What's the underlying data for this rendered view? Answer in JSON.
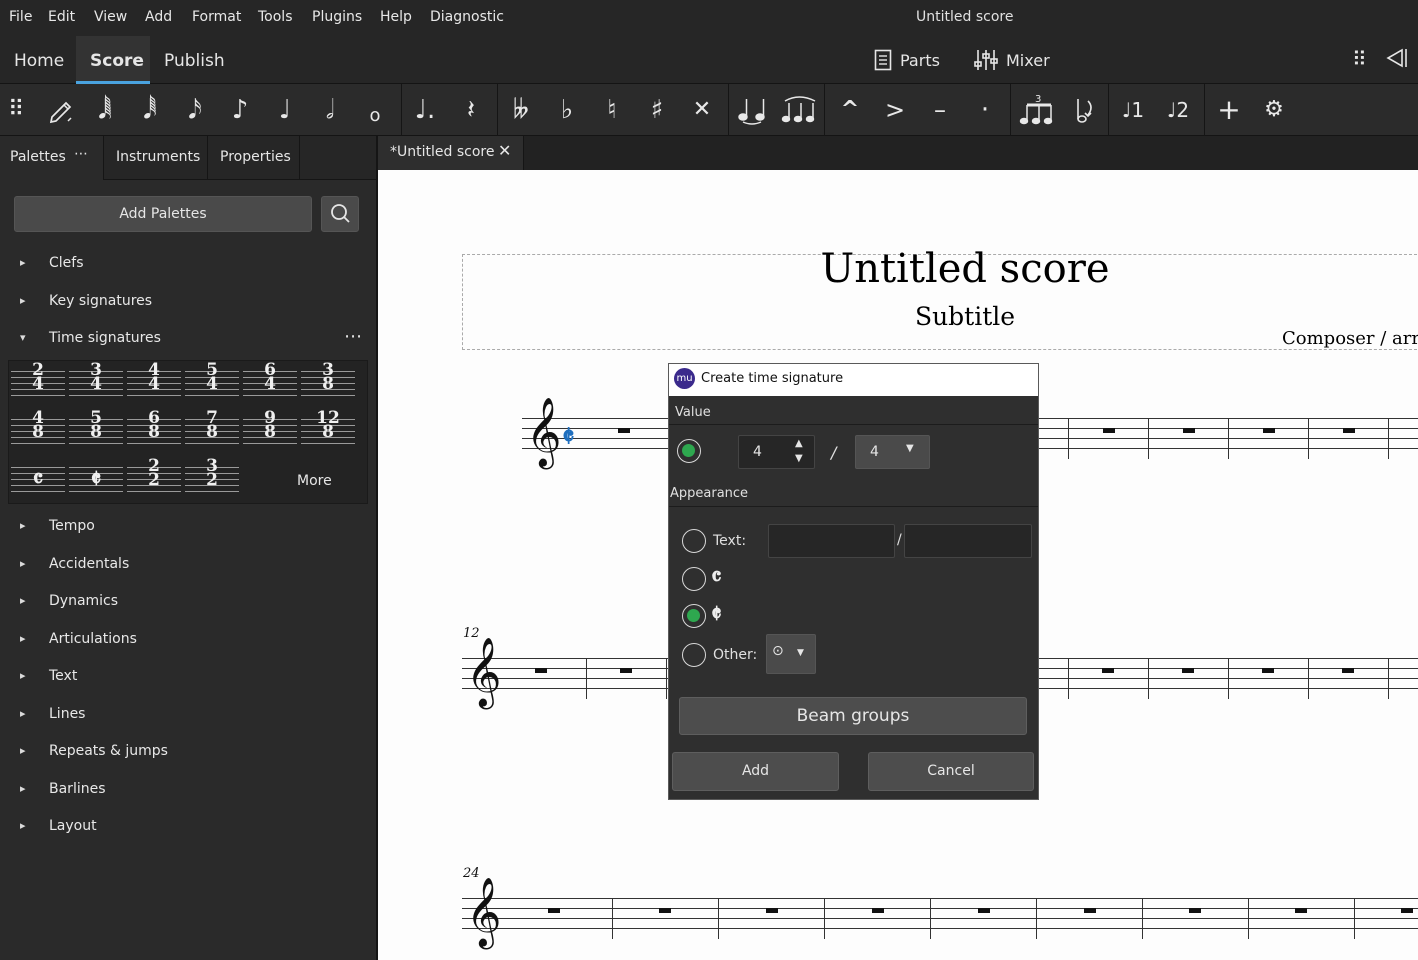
{
  "menu": [
    "File",
    "Edit",
    "View",
    "Add",
    "Format",
    "Tools",
    "Plugins",
    "Help",
    "Diagnostic"
  ],
  "app_title": "Untitled score",
  "workspace_tabs": [
    "Home",
    "Score",
    "Publish"
  ],
  "top_right": {
    "parts": "Parts",
    "mixer": "Mixer"
  },
  "toolbar_icons": [
    "drag-handle-icon",
    "note-input-pen-icon",
    "64th-note-icon",
    "32nd-note-icon",
    "16th-note-icon",
    "eighth-note-icon",
    "quarter-note-icon",
    "half-note-icon",
    "whole-note-icon",
    "augmentation-dot-icon",
    "rest-icon",
    "double-flat-icon",
    "flat-icon",
    "natural-icon",
    "sharp-icon",
    "double-sharp-icon",
    "tie-icon",
    "slur-icon",
    "marcato-icon",
    "accent-icon",
    "tenuto-icon",
    "staccato-icon",
    "tuplet-icon",
    "flip-direction-icon",
    "voice-1-icon",
    "voice-2-icon",
    "add-icon",
    "customize-toolbar-icon"
  ],
  "left_panel": {
    "tabs": [
      "Palettes",
      "Instruments",
      "Properties"
    ],
    "add_palettes": "Add Palettes",
    "palettes_before": [
      "Clefs",
      "Key signatures"
    ],
    "open_palette": "Time signatures",
    "time_signatures": [
      {
        "n": "2",
        "d": "4"
      },
      {
        "n": "3",
        "d": "4"
      },
      {
        "n": "4",
        "d": "4"
      },
      {
        "n": "5",
        "d": "4"
      },
      {
        "n": "6",
        "d": "4"
      },
      {
        "n": "3",
        "d": "8"
      },
      {
        "n": "4",
        "d": "8"
      },
      {
        "n": "5",
        "d": "8"
      },
      {
        "n": "6",
        "d": "8"
      },
      {
        "n": "7",
        "d": "8"
      },
      {
        "n": "9",
        "d": "8"
      },
      {
        "n": "12",
        "d": "8"
      }
    ],
    "time_signature_symbols": [
      "𝄴",
      "𝄵"
    ],
    "time_signature_extra": [
      {
        "n": "2",
        "d": "2"
      },
      {
        "n": "3",
        "d": "2"
      }
    ],
    "more": "More",
    "palettes_after": [
      "Tempo",
      "Accidentals",
      "Dynamics",
      "Articulations",
      "Text",
      "Lines",
      "Repeats & jumps",
      "Barlines",
      "Layout"
    ]
  },
  "document_tab": "*Untitled score",
  "score": {
    "title": "Untitled score",
    "subtitle": "Subtitle",
    "composer": "Composer / arr",
    "measure_numbers": [
      "12",
      "24"
    ]
  },
  "dialog": {
    "title": "Create time signature",
    "logo": "mu",
    "value_label": "Value",
    "numerator": "4",
    "slash": "/",
    "denominator": "4",
    "appearance_label": "Appearance",
    "text_label": "Text:",
    "text_slash": "/",
    "common_time_symbol": "𝄴",
    "cut_time_symbol": "𝄵",
    "other_label": "Other:",
    "other_symbol": "⊙",
    "beam_groups": "Beam groups",
    "add": "Add",
    "cancel": "Cancel",
    "selected_appearance": "cut-time"
  },
  "colors": {
    "accent": "#4aa3df",
    "radio_on": "#2ea84f",
    "selected_sig": "#1f6fbf"
  }
}
